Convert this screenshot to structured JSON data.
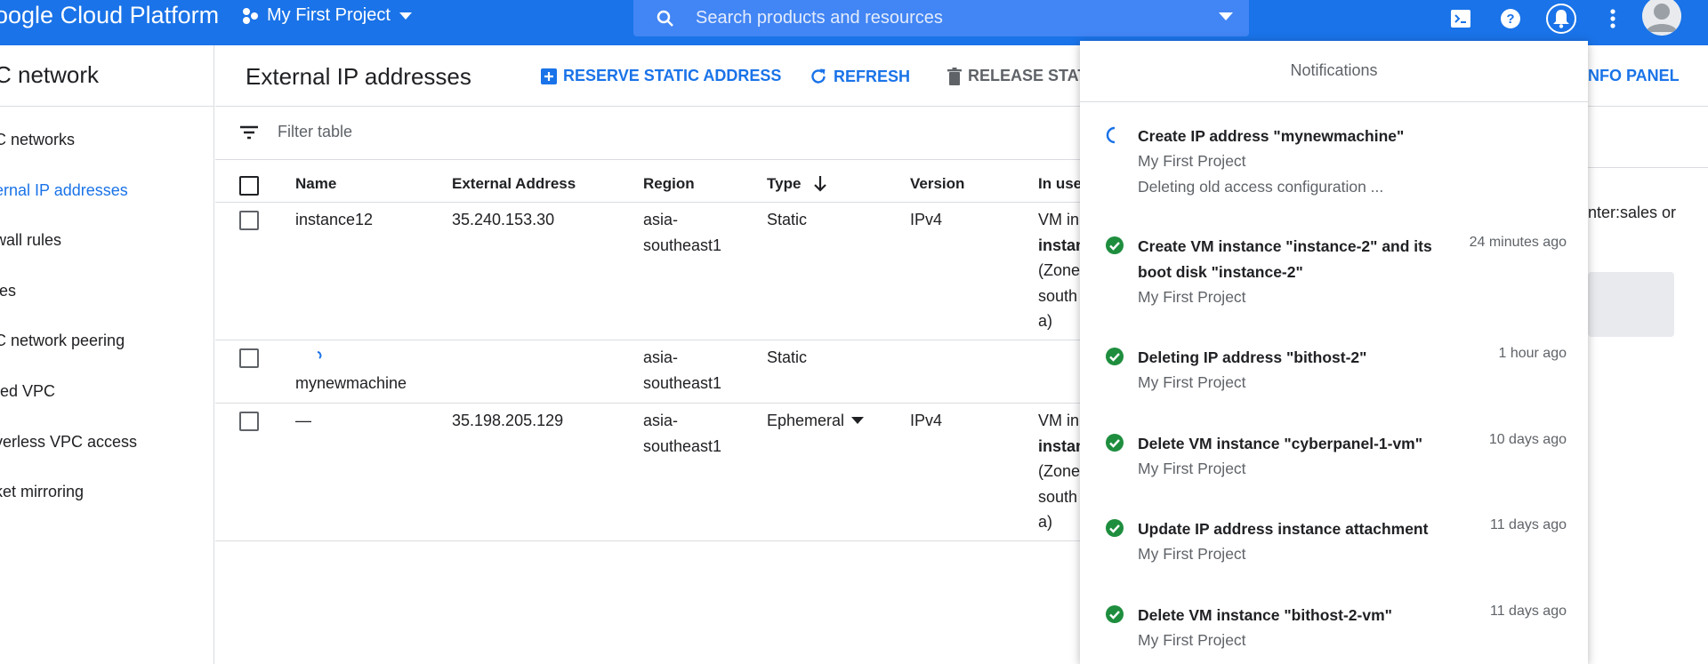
{
  "topbar": {
    "brand": "oogle Cloud Platform",
    "project": "My First Project",
    "search_placeholder": "Search products and resources"
  },
  "sidenav": {
    "title": "C network",
    "items": [
      {
        "label": "C networks",
        "active": false
      },
      {
        "label": "ernal IP addresses",
        "active": true
      },
      {
        "label": "wall rules",
        "active": false
      },
      {
        "label": "tes",
        "active": false
      },
      {
        "label": "C network peering",
        "active": false
      },
      {
        "label": "red VPC",
        "active": false
      },
      {
        "label": "verless VPC access",
        "active": false
      },
      {
        "label": "ket mirroring",
        "active": false
      }
    ]
  },
  "header": {
    "title": "External IP addresses",
    "reserve": "RESERVE STATIC ADDRESS",
    "refresh": "REFRESH",
    "release": "RELEASE STAT",
    "info_panel": "NFO PANEL"
  },
  "filter": {
    "placeholder": "Filter table"
  },
  "table": {
    "columns": [
      "Name",
      "External Address",
      "Region",
      "Type",
      "Version",
      "In use"
    ],
    "rows": [
      {
        "name": "instance12",
        "address": "35.240.153.30",
        "region_1": "asia-",
        "region_2": "southeast1",
        "type": "Static",
        "version": "IPv4",
        "inuse": [
          "VM in",
          "instan",
          "(Zone",
          "south",
          "a)"
        ]
      },
      {
        "name": "mynewmachine",
        "address": "",
        "region_1": "asia-",
        "region_2": "southeast1",
        "type": "Static",
        "version": "",
        "inuse": []
      },
      {
        "name": "—",
        "address": "35.198.205.129",
        "region_1": "asia-",
        "region_2": "southeast1",
        "type": "Ephemeral",
        "version": "IPv4",
        "inuse": [
          "VM in",
          "instan",
          "(Zone",
          "south",
          "a)"
        ]
      }
    ]
  },
  "right_panel": {
    "text": "nter:sales or"
  },
  "notifications": {
    "title": "Notifications",
    "items": [
      {
        "title": "Create IP address \"mynewmachine\"",
        "project": "My First Project",
        "sub": "Deleting old access configuration ...",
        "time": "",
        "status": "in-progress"
      },
      {
        "title": "Create VM instance \"instance-2\" and its boot disk \"instance-2\"",
        "project": "My First Project",
        "sub": "",
        "time": "24 minutes ago",
        "status": "done"
      },
      {
        "title": "Deleting IP address \"bithost-2\"",
        "project": "My First Project",
        "sub": "",
        "time": "1 hour ago",
        "status": "done"
      },
      {
        "title": "Delete VM instance \"cyberpanel-1-vm\"",
        "project": "My First Project",
        "sub": "",
        "time": "10 days ago",
        "status": "done"
      },
      {
        "title": "Update IP address instance attachment",
        "project": "My First Project",
        "sub": "",
        "time": "11 days ago",
        "status": "done"
      },
      {
        "title": "Delete VM instance \"bithost-2-vm\"",
        "project": "My First Project",
        "sub": "",
        "time": "11 days ago",
        "status": "done"
      }
    ]
  },
  "colors": {
    "brand_blue": "#1a73e8",
    "success_green": "#1e8e3e",
    "text": "#202124",
    "muted": "#5f6368"
  }
}
